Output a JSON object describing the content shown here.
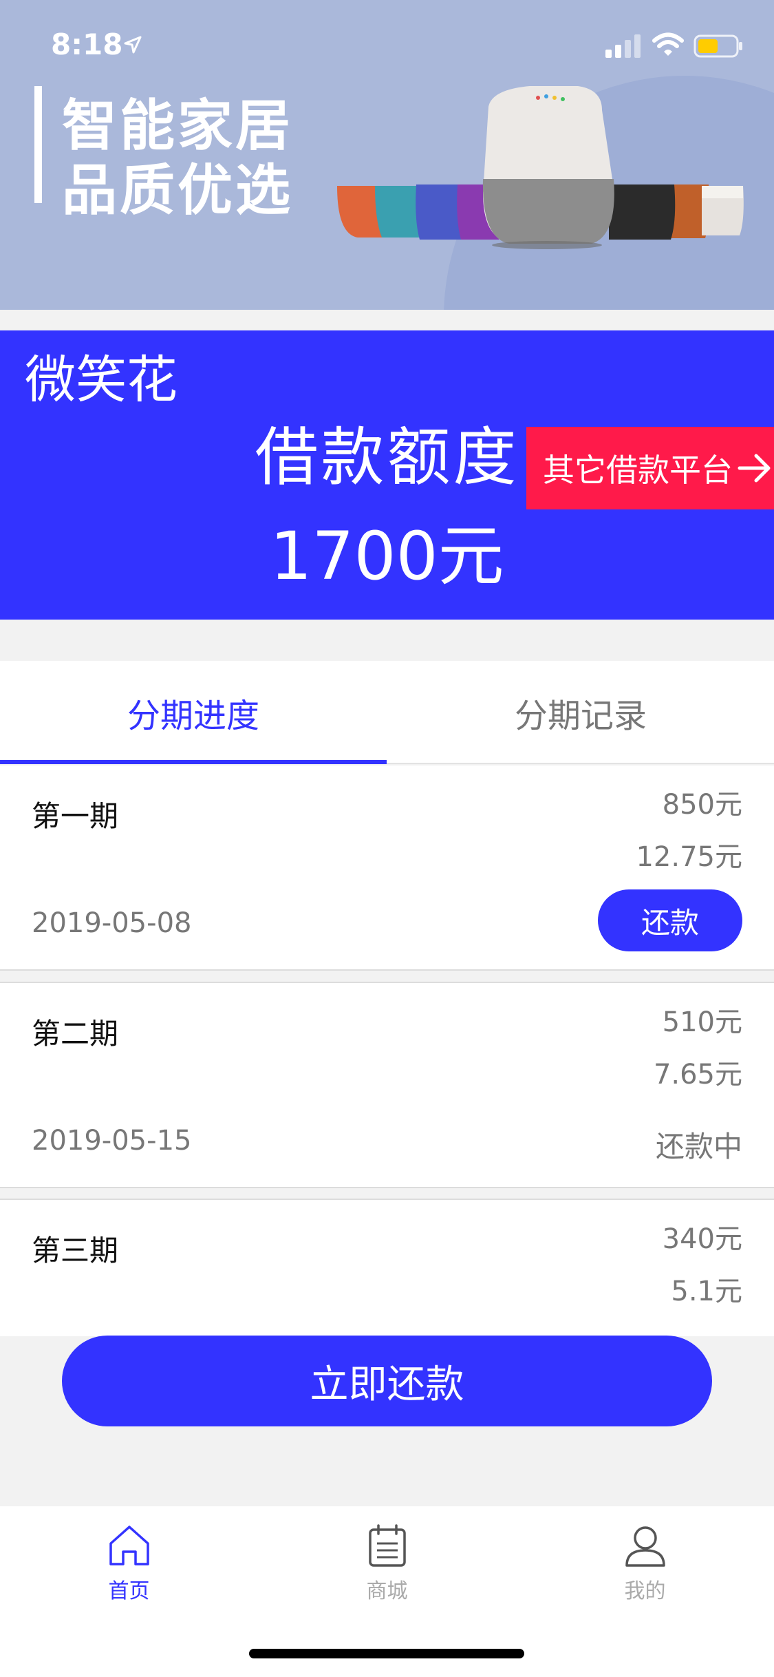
{
  "status_bar": {
    "time": "8:18"
  },
  "banner": {
    "slogan_line1": "智能家居",
    "slogan_line2": "品质优选"
  },
  "loan_card": {
    "brand": "微笑花",
    "label": "借款额度",
    "amount": "1700元",
    "other_platform": "其它借款平台"
  },
  "tabs": [
    {
      "label": "分期进度",
      "active": true
    },
    {
      "label": "分期记录",
      "active": false
    }
  ],
  "installments": [
    {
      "period": "第一期",
      "principal": "850元",
      "interest": "12.75元",
      "date": "2019-05-08",
      "action": "还款"
    },
    {
      "period": "第二期",
      "principal": "510元",
      "interest": "7.65元",
      "date": "2019-05-15",
      "status": "还款中"
    },
    {
      "period": "第三期",
      "principal": "340元",
      "interest": "5.1元"
    }
  ],
  "repay_now": "立即还款",
  "bottom_nav": [
    {
      "label": "首页",
      "icon": "home-icon",
      "active": true
    },
    {
      "label": "商城",
      "icon": "calendar-icon",
      "active": false
    },
    {
      "label": "我的",
      "icon": "user-icon",
      "active": false
    }
  ],
  "colors": {
    "primary": "#3333ff",
    "accent_red": "#ff1a4a",
    "banner_bg": "#aab8da",
    "battery_yellow": "#ffcc00"
  }
}
